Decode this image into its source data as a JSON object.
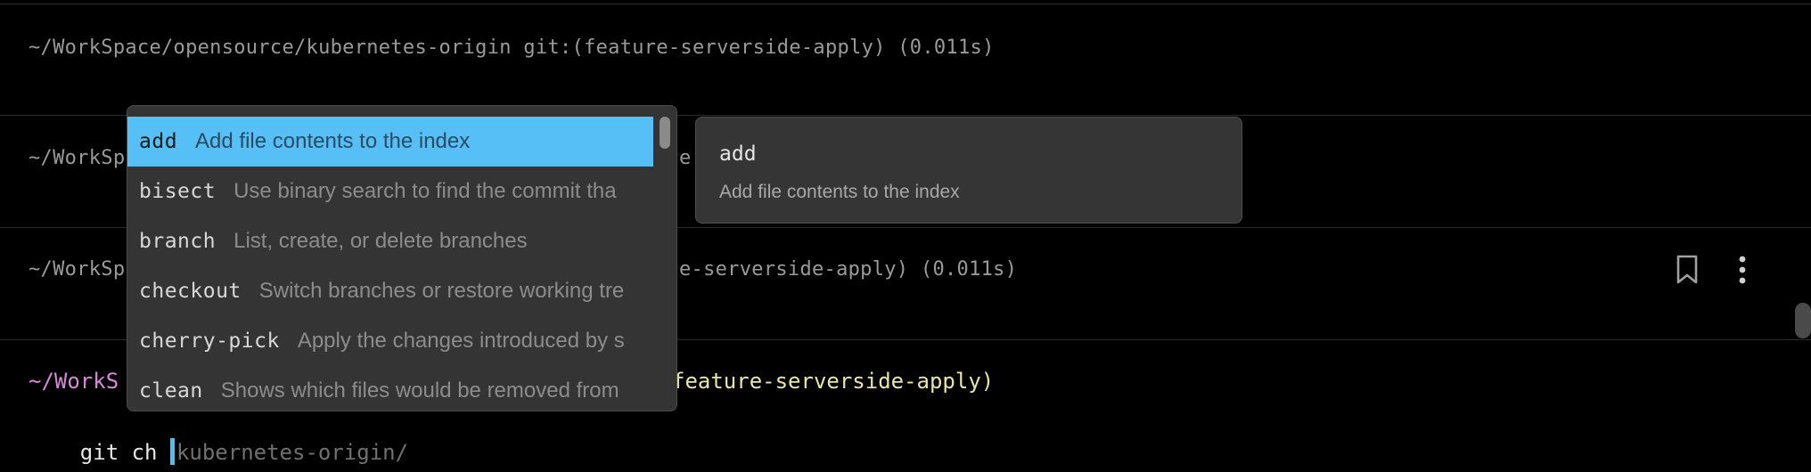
{
  "blocks": [
    {
      "prompt_visible": "~/WorkSpace/opensource/kubernetes-origin git:(feature-serverside-apply) (0.011s)"
    },
    {
      "prompt_left": "~/WorkSp",
      "prompt_right": "e"
    },
    {
      "prompt_left": "~/WorkSp",
      "prompt_right": "e-serverside-apply) (0.011s)"
    }
  ],
  "active_prompt": {
    "path_visible": "~/WorkS",
    "branch_visible": "feature-serverside-apply)",
    "input": "git ch ",
    "ghost_suggestion": "kubernetes-origin/"
  },
  "block_actions": {
    "bookmark_icon": "bookmark-icon",
    "more_icon": "more-vertical-icon"
  },
  "completion_menu": {
    "items": [
      {
        "command": "add",
        "description": "Add file contents to the index",
        "selected": true
      },
      {
        "command": "bisect",
        "description": "Use binary search to find the commit tha",
        "selected": false
      },
      {
        "command": "branch",
        "description": "List, create, or delete branches",
        "selected": false
      },
      {
        "command": "checkout",
        "description": "Switch branches or restore working tre",
        "selected": false
      },
      {
        "command": "cherry-pick",
        "description": "Apply the changes introduced by s",
        "selected": false
      },
      {
        "command": "clean",
        "description": "Shows which files would be removed from",
        "selected": false
      }
    ]
  },
  "detail_panel": {
    "title": "add",
    "description": "Add file contents to the index"
  },
  "colors": {
    "background": "#000000",
    "selection": "#56bff5",
    "cursor": "#4fc0f7",
    "path": "#d58ad8",
    "branch": "#e8e6a8",
    "menu_bg": "#343434"
  }
}
